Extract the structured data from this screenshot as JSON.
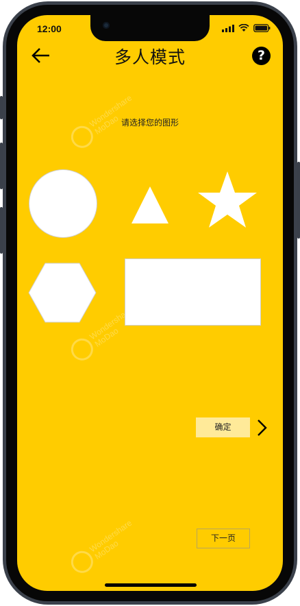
{
  "status_bar": {
    "time": "12:00",
    "icons": [
      "signal-icon",
      "wifi-icon",
      "battery-icon"
    ]
  },
  "header": {
    "title": "多人模式",
    "back_icon": "arrow-left-icon",
    "help_icon": "question-circle-icon",
    "help_symbol": "?"
  },
  "prompt": "请选择您的图形",
  "shapes": [
    {
      "name": "circle"
    },
    {
      "name": "triangle"
    },
    {
      "name": "star"
    },
    {
      "name": "hexagon"
    },
    {
      "name": "rectangle"
    }
  ],
  "actions": {
    "confirm_label": "确定",
    "next_page_label": "下一页",
    "chevron_icon": "chevron-right-icon"
  },
  "watermark": {
    "line1": "Wondershare",
    "line2": "MoDao"
  },
  "colors": {
    "background": "#ffcc00",
    "shape_fill": "#ffffff",
    "confirm_bg": "#ffea99"
  }
}
